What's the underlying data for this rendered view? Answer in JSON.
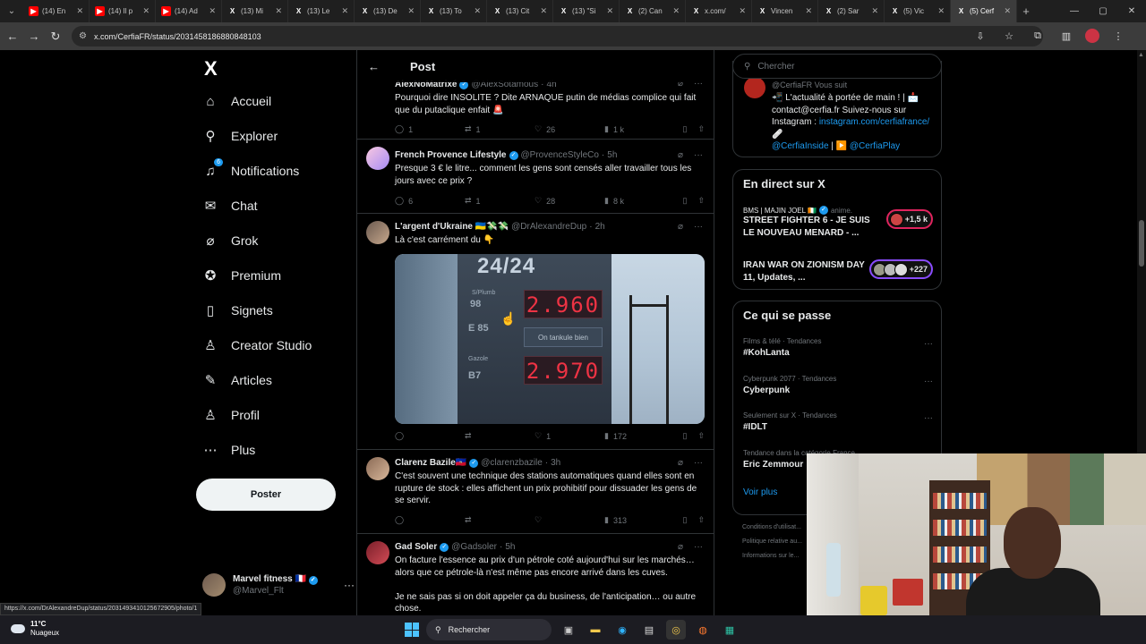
{
  "browser": {
    "tabs": [
      {
        "title": "(14) En",
        "type": "yt"
      },
      {
        "title": "(14) Il p",
        "type": "yt"
      },
      {
        "title": "(14) Ad",
        "type": "yt"
      },
      {
        "title": "(13) Mi",
        "type": "x"
      },
      {
        "title": "(13) Le",
        "type": "x"
      },
      {
        "title": "(13) De",
        "type": "x"
      },
      {
        "title": "(13) To",
        "type": "x"
      },
      {
        "title": "(13) Cit",
        "type": "x"
      },
      {
        "title": "(13) \"Si",
        "type": "x"
      },
      {
        "title": "(2) Can",
        "type": "x"
      },
      {
        "title": "x.com/",
        "type": "x"
      },
      {
        "title": "Vincen",
        "type": "x"
      },
      {
        "title": "(2) Sar",
        "type": "x"
      },
      {
        "title": "(5) Vic",
        "type": "x"
      },
      {
        "title": "(5) Cerf",
        "type": "x",
        "active": true
      }
    ],
    "url": "x.com/CerfiaFR/status/2031458186880848103",
    "hover_url": "https://x.com/DrAlexandreDup/status/2031493410125672905/photo/1"
  },
  "nav": {
    "logo": "X",
    "items": [
      {
        "label": "Accueil",
        "icon": "home-icon",
        "glyph": "⌂"
      },
      {
        "label": "Explorer",
        "icon": "search-icon",
        "glyph": "⚲"
      },
      {
        "label": "Notifications",
        "icon": "bell-icon",
        "glyph": "♫"
      },
      {
        "label": "Chat",
        "icon": "mail-icon",
        "glyph": "✉"
      },
      {
        "label": "Grok",
        "icon": "grok-icon",
        "glyph": "⌀"
      },
      {
        "label": "Premium",
        "icon": "premium-icon",
        "glyph": "✪"
      },
      {
        "label": "Signets",
        "icon": "bookmark-icon",
        "glyph": "▯"
      },
      {
        "label": "Creator Studio",
        "icon": "creator-icon",
        "glyph": "♙"
      },
      {
        "label": "Articles",
        "icon": "article-icon",
        "glyph": "✎"
      },
      {
        "label": "Profil",
        "icon": "person-icon",
        "glyph": "♙"
      },
      {
        "label": "Plus",
        "icon": "more-circle-icon",
        "glyph": "⋯"
      }
    ],
    "notif_badge": "6",
    "post_button": "Poster",
    "account": {
      "name": "Marvel fitness 🇫🇷",
      "handle": "@Marvel_Flt"
    }
  },
  "timeline": {
    "header_title": "Post",
    "tweets": [
      {
        "name": "AlexNoMatrixé",
        "handle": "@AlexSotamous",
        "time": "4h",
        "text": "Pourquoi dire INSOLITE ? Dite ARNAQUE putin de médias complice qui fait que du putaclique enfait 🚨",
        "replies": "1",
        "reposts": "1",
        "likes": "26",
        "views": "1 k"
      },
      {
        "name": "French Provence Lifestyle",
        "handle": "@ProvenceStyleCo",
        "time": "5h",
        "text": "Presque 3 € le litre... comment les gens sont censés aller travailler tous les jours avec ce prix ?",
        "replies": "6",
        "reposts": "1",
        "likes": "28",
        "views": "8 k"
      },
      {
        "name": "L'argent d'Ukraine 🇺🇦💸💸",
        "handle": "@DrAlexandreDup",
        "time": "2h",
        "text": "Là c'est carrément du 👇",
        "replies": "",
        "reposts": "",
        "likes": "1",
        "views": "172",
        "media": {
          "head": "24/24",
          "label1": "S/Plumb",
          "num1": "98",
          "label2": "E 85",
          "price1": "2.960",
          "tag": "On tankule bien",
          "label3": "Gazole",
          "num3": "B7",
          "price2": "2.970"
        }
      },
      {
        "name": "Clarenz Bazile🇭🇹",
        "handle": "@clarenzbazile",
        "time": "3h",
        "text": "C'est souvent une technique des stations automatiques quand elles sont en rupture de stock : elles affichent un prix prohibitif pour dissuader les gens de se servir.",
        "replies": "",
        "reposts": "",
        "likes": "",
        "views": "313"
      },
      {
        "name": "Gad Soler",
        "handle": "@Gadsoler",
        "time": "5h",
        "text": "On facture l'essence au prix d'un pétrole coté aujourd'hui sur les marchés… alors que ce pétrole-là n'est même pas encore arrivé dans les cuves.\n\nJe ne sais pas si on doit appeler ça du business, de l'anticipation… ou autre chose."
      }
    ]
  },
  "right": {
    "search_placeholder": "Chercher",
    "profile_card": {
      "topline": "@CerfiaFR  Vous suit",
      "bio": "📲 L'actualité à portée de main ! | 📩 contact@cerfia.fr Suivez-nous sur Instagram :",
      "link1": "instagram.com/cerfiafrance/ 🩹",
      "link2": "@CerfiaInside",
      "sep": " | ▶️ ",
      "link3": "@CerfiaPlay"
    },
    "live": {
      "title": "En direct sur X",
      "items": [
        {
          "source": "BMS | MAJIN JOEL 🇨🇮",
          "sub": "anime.",
          "title": "STREET FIGHTER 6 - JE SUIS LE NOUVEAU MENARD - ...",
          "count": "+1,5 k"
        },
        {
          "source": "",
          "sub": "",
          "title": "IRAN WAR ON ZIONISM DAY 11, Updates, ...",
          "count": "+227"
        }
      ]
    },
    "trends": {
      "title": "Ce qui se passe",
      "items": [
        {
          "context": "Films & télé · Tendances",
          "name": "#KohLanta"
        },
        {
          "context": "Cyberpunk 2077 · Tendances",
          "name": "Cyberpunk"
        },
        {
          "context": "Seulement sur X · Tendances",
          "name": "#IDLT"
        },
        {
          "context": "Tendance dans la catégorie France",
          "name": "Eric Zemmour"
        }
      ],
      "show_more": "Voir plus"
    },
    "footer": [
      "Conditions d'utilisat...",
      "Politique relative au...",
      "Informations sur le..."
    ]
  },
  "taskbar": {
    "temp": "11°C",
    "weather": "Nuageux",
    "search": "Rechercher"
  }
}
